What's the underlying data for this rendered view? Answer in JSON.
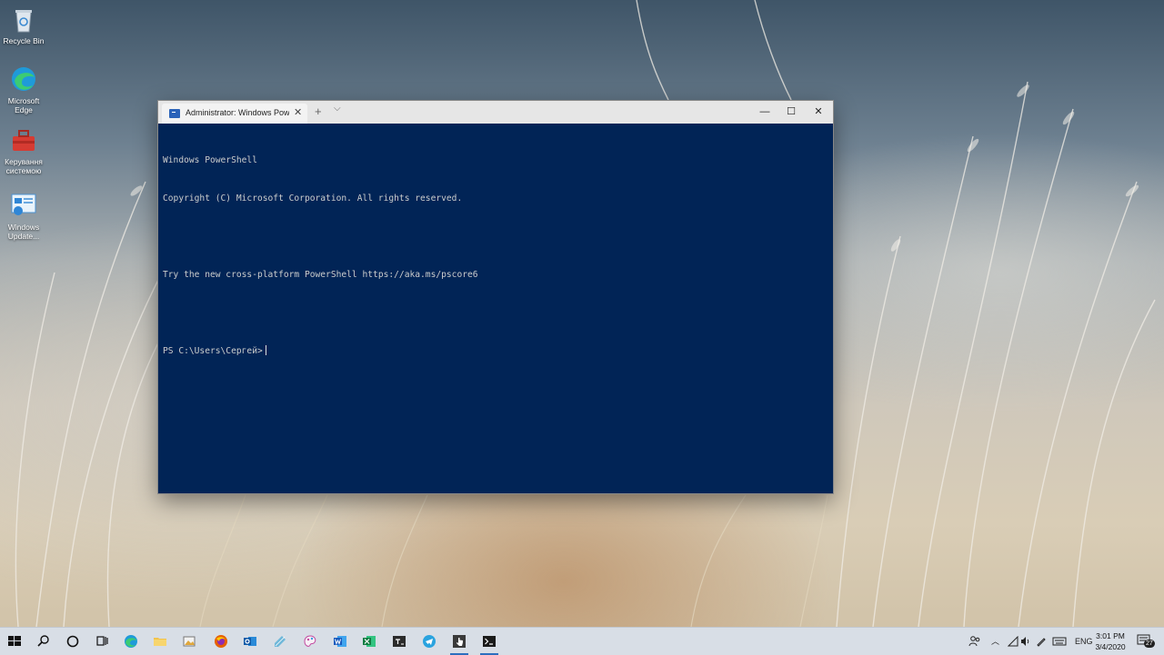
{
  "desktop": {
    "icons": [
      {
        "name": "recycle-bin",
        "label": "Recycle Bin"
      },
      {
        "name": "microsoft-edge",
        "label": "Microsoft Edge"
      },
      {
        "name": "control-panel",
        "label": "Керування системою"
      },
      {
        "name": "windows-update",
        "label": "Windows Update..."
      }
    ]
  },
  "window": {
    "tab_title": "Administrator: Windows PowerS",
    "tab_close": "✕",
    "new_tab": "+",
    "dropdown": "⌵",
    "minimize": "—",
    "maximize": "☐",
    "close": "✕"
  },
  "terminal": {
    "lines": [
      "Windows PowerShell",
      "Copyright (C) Microsoft Corporation. All rights reserved.",
      "",
      "Try the new cross-platform PowerShell https://aka.ms/pscore6",
      ""
    ],
    "prompt": "PS C:\\Users\\Сергей>"
  },
  "taskbar": {
    "apps": [
      "start-icon",
      "search-icon",
      "task-view-icon",
      "timeline-icon",
      "edge-icon",
      "file-explorer-icon",
      "store-icon",
      "firefox-icon",
      "outlook-icon",
      "notepad-icon",
      "paint-icon",
      "word-icon",
      "excel-icon",
      "terminal-icon",
      "telegram-icon",
      "clipboard-icon",
      "powershell-icon"
    ],
    "tray": {
      "language": "ENG",
      "time": "3:01 PM",
      "date": "3/4/2020",
      "notifications": "27"
    }
  },
  "colors": {
    "terminal_bg": "#012456",
    "terminal_fg": "#cccccc",
    "accent": "#2c6fbf"
  }
}
